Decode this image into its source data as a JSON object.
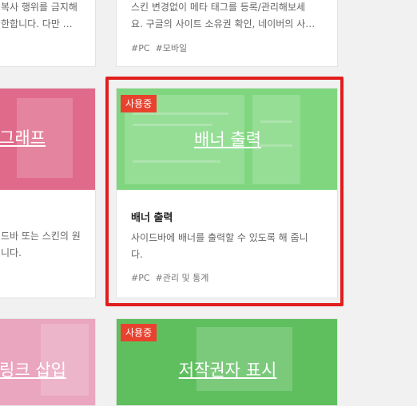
{
  "cards_top": {
    "left": {
      "desc_lines": [
        "복사 행위를 금지해",
        "한합니다. 다만 …"
      ]
    },
    "right": {
      "desc_lines": [
        "스킨 변경없이 메타 태그를 등록/관리해보세",
        "요. 구글의 사이트 소유권 확인, 네이버의 사…"
      ],
      "tags": [
        "#PC",
        "#모바일"
      ]
    }
  },
  "cards_mid": {
    "left": {
      "banner_title": "그래프",
      "desc_lines": [
        "드바 또는 스킨의 원",
        "니다."
      ],
      "banner_color": "#e06a8a"
    },
    "center": {
      "badge": "사용중",
      "banner_title": "배너 출력",
      "title": "배너 출력",
      "desc_lines": [
        "사이드바에 배너를 출력할 수 있도록 해 줍니",
        "다."
      ],
      "tags": [
        "#PC",
        "#관리 및 통계"
      ],
      "banner_color": "#7fd67f"
    }
  },
  "cards_bottom": {
    "left": {
      "banner_title": "링크 삽입",
      "banner_color": "#eaa5bf"
    },
    "center": {
      "badge": "사용중",
      "banner_title": "저작권자 표시",
      "banner_color": "#5fbf5f"
    }
  },
  "colors": {
    "highlight": "#e11d1d",
    "badge": "#e8422f"
  }
}
